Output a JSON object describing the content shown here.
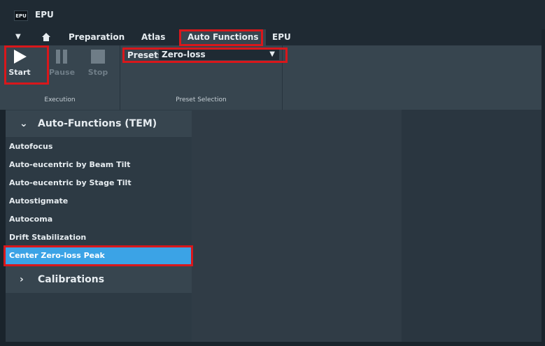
{
  "app": {
    "logo_text": "EPU",
    "title": "EPU"
  },
  "tabs": [
    {
      "label": "Preparation"
    },
    {
      "label": "Atlas"
    },
    {
      "label": "Auto Functions"
    },
    {
      "label": "EPU"
    }
  ],
  "ribbon": {
    "execution": {
      "start_label": "Start",
      "pause_label": "Pause",
      "stop_label": "Stop",
      "group_label": "Execution"
    },
    "preset_selection": {
      "presets_label": "Presets",
      "selected_value": "Zero-loss",
      "group_label": "Preset Selection"
    }
  },
  "panel": {
    "auto_functions_header": "Auto-Functions (TEM)",
    "items": [
      {
        "label": "Autofocus"
      },
      {
        "label": "Auto-eucentric by Beam Tilt"
      },
      {
        "label": "Auto-eucentric by Stage Tilt"
      },
      {
        "label": "Autostigmate"
      },
      {
        "label": "Autocoma"
      },
      {
        "label": "Drift Stabilization"
      },
      {
        "label": "Center Zero-loss Peak"
      }
    ],
    "calibrations_header": "Calibrations"
  },
  "colors": {
    "highlight": "#d9171b",
    "selected_item": "#3ba3e6"
  }
}
